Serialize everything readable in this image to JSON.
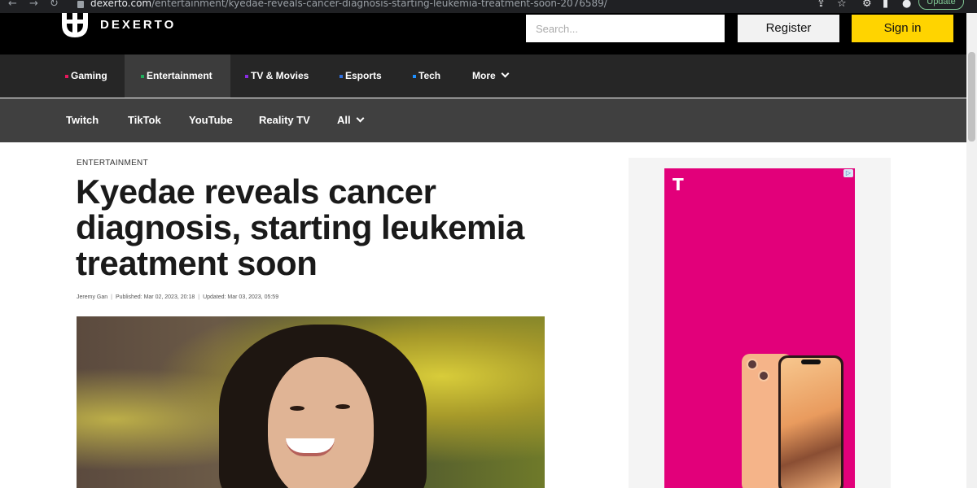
{
  "browser": {
    "url_domain": "dexerto.com",
    "url_path": "/entertainment/kyedae-reveals-cancer-diagnosis-starting-leukemia-treatment-soon-2076589/",
    "update_label": "Update"
  },
  "header": {
    "logo_text": "DEXERTO",
    "search_placeholder": "Search...",
    "register_label": "Register",
    "signin_label": "Sign in"
  },
  "primary_nav": [
    {
      "label": "Gaming",
      "color": "#e8175d"
    },
    {
      "label": "Entertainment",
      "color": "#1fae5b"
    },
    {
      "label": "TV & Movies",
      "color": "#8a2be2"
    },
    {
      "label": "Esports",
      "color": "#2f6fe0"
    },
    {
      "label": "Tech",
      "color": "#1e90ff"
    },
    {
      "label": "More"
    }
  ],
  "secondary_nav": [
    "Twitch",
    "TikTok",
    "YouTube",
    "Reality TV",
    "All"
  ],
  "article": {
    "category": "ENTERTAINMENT",
    "headline": "Kyedae reveals cancer diagnosis, starting leukemia treatment soon",
    "author": "Jeremy Gan",
    "published": "Published: Mar 02, 2023, 20:18",
    "updated": "Updated: Mar 03, 2023, 05:59"
  },
  "ad": {
    "logo": "T",
    "brand_color": "#e2007a"
  }
}
